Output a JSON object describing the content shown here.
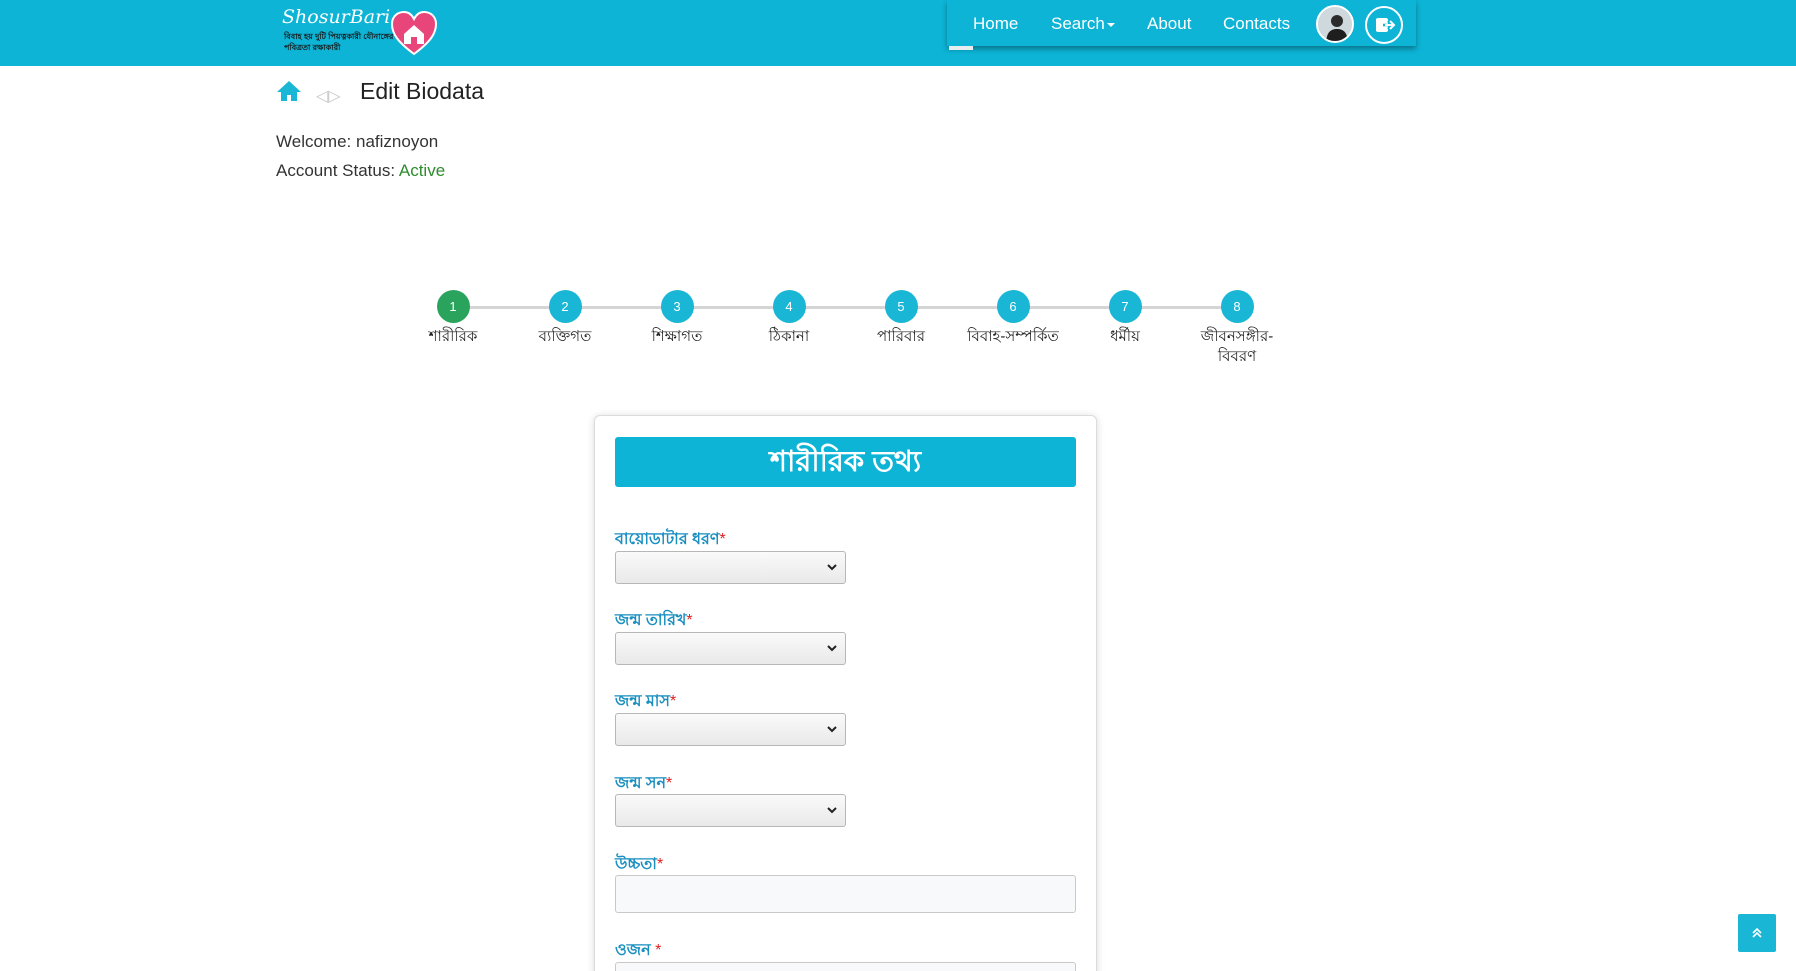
{
  "header": {
    "logo_name": "ShosurBari",
    "logo_tagline": "বিবাহ হয় দুটি পিয়ত্নকারী যৌনাঙ্গের পবিত্রতা রক্ষাকারী",
    "nav": {
      "home": "Home",
      "search": "Search",
      "about": "About",
      "contacts": "Contacts"
    }
  },
  "breadcrumb": {
    "separator": "◁▷",
    "title": "Edit Biodata"
  },
  "user": {
    "welcome_label": "Welcome:",
    "username": "nafiznoyon",
    "status_label": "Account Status:",
    "status_value": "Active"
  },
  "steps": [
    {
      "num": "1",
      "label": "শারীরিক"
    },
    {
      "num": "2",
      "label": "ব্যক্তিগত"
    },
    {
      "num": "3",
      "label": "শিক্ষাগত"
    },
    {
      "num": "4",
      "label": "ঠিকানা"
    },
    {
      "num": "5",
      "label": "পারিবার"
    },
    {
      "num": "6",
      "label": "বিবাহ-সম্পর্কিত"
    },
    {
      "num": "7",
      "label": "ধর্মীয়"
    },
    {
      "num": "8",
      "label": "জীবনসঙ্গীর-বিবরণ"
    }
  ],
  "form": {
    "heading": "শারীরিক তথ্য",
    "fields": [
      {
        "label": "বায়োডাটার ধরণ",
        "required": "*"
      },
      {
        "label": "জন্ম তারিখ",
        "required": "*"
      },
      {
        "label": "জন্ম মাস",
        "required": "*"
      },
      {
        "label": "জন্ম সন",
        "required": "*"
      },
      {
        "label": "উচ্চতা",
        "required": "*"
      },
      {
        "label": "ওজন ",
        "required": "*"
      }
    ]
  },
  "colors": {
    "brand": "#0db4d6",
    "active_step": "#2aa35c",
    "status_active": "#2e8b2e",
    "required": "#e02020"
  },
  "icons": [
    "home-icon",
    "logout-icon",
    "chevron-down-icon",
    "chevron-up-icon",
    "heart-house-icon"
  ]
}
